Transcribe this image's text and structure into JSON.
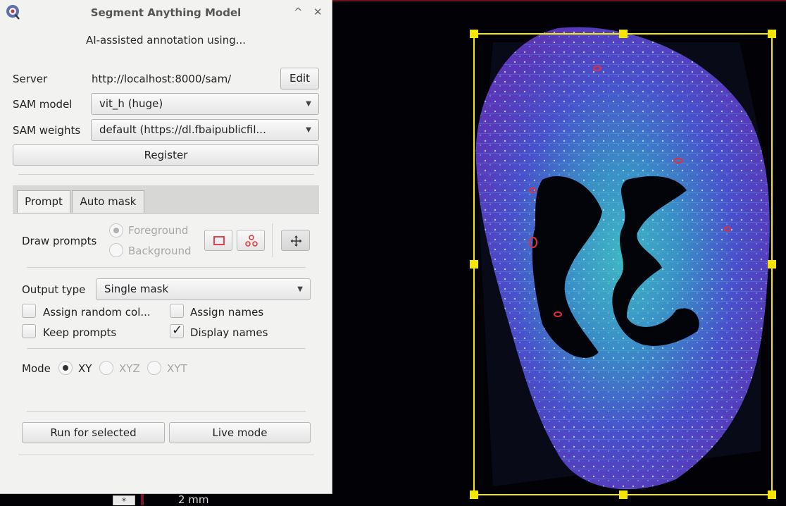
{
  "dialog": {
    "title": "Segment Anything Model",
    "win_up": "^",
    "win_close": "✕",
    "subtitle": "AI-assisted annotation using...",
    "server_label": "Server",
    "server_url": "http://localhost:8000/sam/",
    "edit_label": "Edit",
    "sam_model_label": "SAM model",
    "sam_model_value": "vit_h (huge)",
    "sam_weights_label": "SAM weights",
    "sam_weights_value": "default (https://dl.fbaipublicfil...",
    "register_label": "Register",
    "tabs": [
      {
        "label": "Prompt",
        "active": true
      },
      {
        "label": "Auto mask",
        "active": false
      }
    ],
    "draw_prompts_label": "Draw prompts",
    "foreground_label": "Foreground",
    "background_label": "Background",
    "output_type_label": "Output type",
    "output_type_value": "Single mask",
    "assign_random_label": "Assign random col...",
    "assign_names_label": "Assign names",
    "keep_prompts_label": "Keep prompts",
    "display_names_label": "Display names",
    "mode_label": "Mode",
    "mode_options": [
      "XY",
      "XYZ",
      "XYT"
    ],
    "run_selected_label": "Run for selected",
    "live_mode_label": "Live mode"
  },
  "viewer": {
    "scalebar": "2 mm",
    "corner_widget": "*",
    "selection_color": "#f4e600",
    "accent_red": "#e0303a"
  }
}
